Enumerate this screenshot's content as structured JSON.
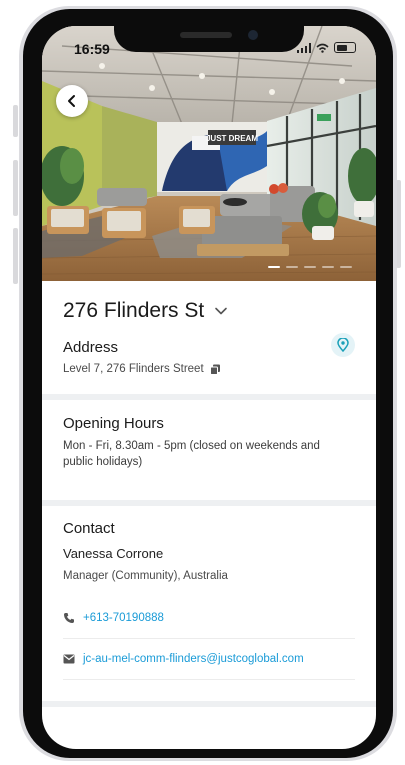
{
  "status_bar": {
    "time": "16:59"
  },
  "location": {
    "title": "276 Flinders St"
  },
  "hero": {
    "sign_text": "JUST DREAM"
  },
  "address": {
    "heading": "Address",
    "line": "Level 7, 276 Flinders Street"
  },
  "opening_hours": {
    "heading": "Opening Hours",
    "text": "Mon - Fri, 8.30am - 5pm (closed on weekends and public holidays)"
  },
  "contact": {
    "heading": "Contact",
    "name": "Vanessa Corrone",
    "role": "Manager (Community), Australia",
    "phone": "+613-70190888",
    "email": "jc-au-mel-comm-flinders@justcoglobal.com"
  },
  "colors": {
    "accent": "#1a9bd7",
    "pin_bg": "#e4f3f7",
    "separator": "#eef0f2"
  },
  "icons": [
    "back-arrow-icon",
    "chevron-down-icon",
    "map-pin-icon",
    "copy-icon",
    "phone-icon",
    "mail-icon"
  ]
}
